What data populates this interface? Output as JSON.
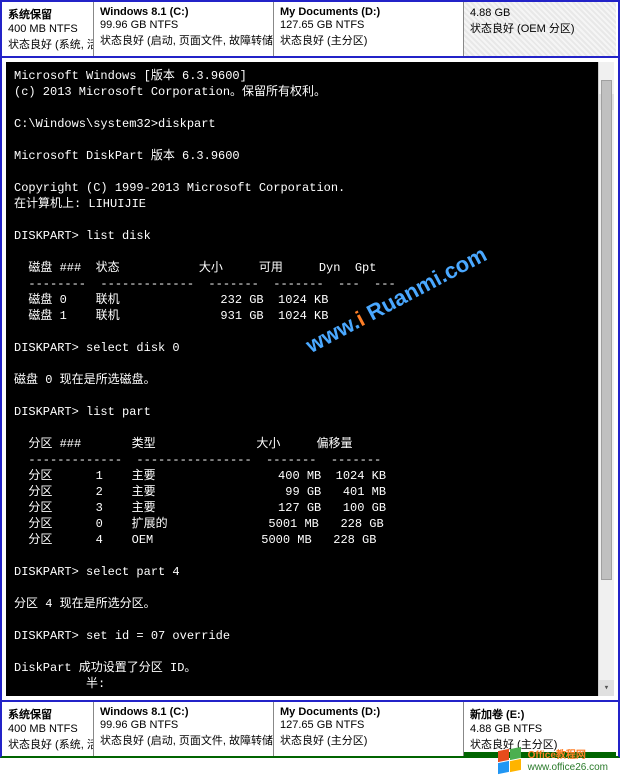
{
  "partitions_top": [
    {
      "title": "系统保留",
      "size": "400 MB NTFS",
      "status": "状态良好 (系统, 活"
    },
    {
      "title": "Windows 8.1  (C:)",
      "size": "99.96 GB NTFS",
      "status": "状态良好 (启动, 页面文件, 故障转储,"
    },
    {
      "title": "My Documents  (D:)",
      "size": "127.65 GB NTFS",
      "status": "状态良好 (主分区)"
    },
    {
      "title": "",
      "size": "4.88 GB",
      "status": "状态良好 (OEM 分区)"
    }
  ],
  "partitions_bottom": [
    {
      "title": "系统保留",
      "size": "400 MB NTFS",
      "status": "状态良好 (系统, 活"
    },
    {
      "title": "Windows 8.1  (C:)",
      "size": "99.96 GB NTFS",
      "status": "状态良好 (启动, 页面文件, 故障转储,"
    },
    {
      "title": "My Documents  (D:)",
      "size": "127.65 GB NTFS",
      "status": "状态良好 (主分区)"
    },
    {
      "title": "新加卷  (E:)",
      "size": "4.88 GB NTFS",
      "status": "状态良好 (主分区)"
    }
  ],
  "terminal_lines": [
    "Microsoft Windows [版本 6.3.9600]",
    "(c) 2013 Microsoft Corporation。保留所有权利。",
    "",
    "C:\\Windows\\system32>diskpart",
    "",
    "Microsoft DiskPart 版本 6.3.9600",
    "",
    "Copyright (C) 1999-2013 Microsoft Corporation.",
    "在计算机上: LIHUIJIE",
    "",
    "DISKPART> list disk",
    "",
    "  磁盘 ###  状态           大小     可用     Dyn  Gpt",
    "  --------  -------------  -------  -------  ---  ---",
    "  磁盘 0    联机              232 GB  1024 KB",
    "  磁盘 1    联机              931 GB  1024 KB",
    "",
    "DISKPART> select disk 0",
    "",
    "磁盘 0 现在是所选磁盘。",
    "",
    "DISKPART> list part",
    "",
    "  分区 ###       类型              大小     偏移量",
    "  -------------  ----------------  -------  -------",
    "  分区      1    主要                 400 MB  1024 KB",
    "  分区      2    主要                  99 GB   401 MB",
    "  分区      3    主要                 127 GB   100 GB",
    "  分区      0    扩展的              5001 MB   228 GB",
    "  分区      4    OEM               5000 MB   228 GB",
    "",
    "DISKPART> select part 4",
    "",
    "分区 4 现在是所选分区。",
    "",
    "DISKPART> set id = 07 override",
    "",
    "DiskPart 成功设置了分区 ID。",
    "          半:"
  ],
  "watermark": {
    "prefix": "www.",
    "i": "i ",
    "main": "Ruanmi",
    "suffix": ".com"
  },
  "logo": {
    "line1": "Office教程网",
    "line2": "www.office26.com"
  }
}
